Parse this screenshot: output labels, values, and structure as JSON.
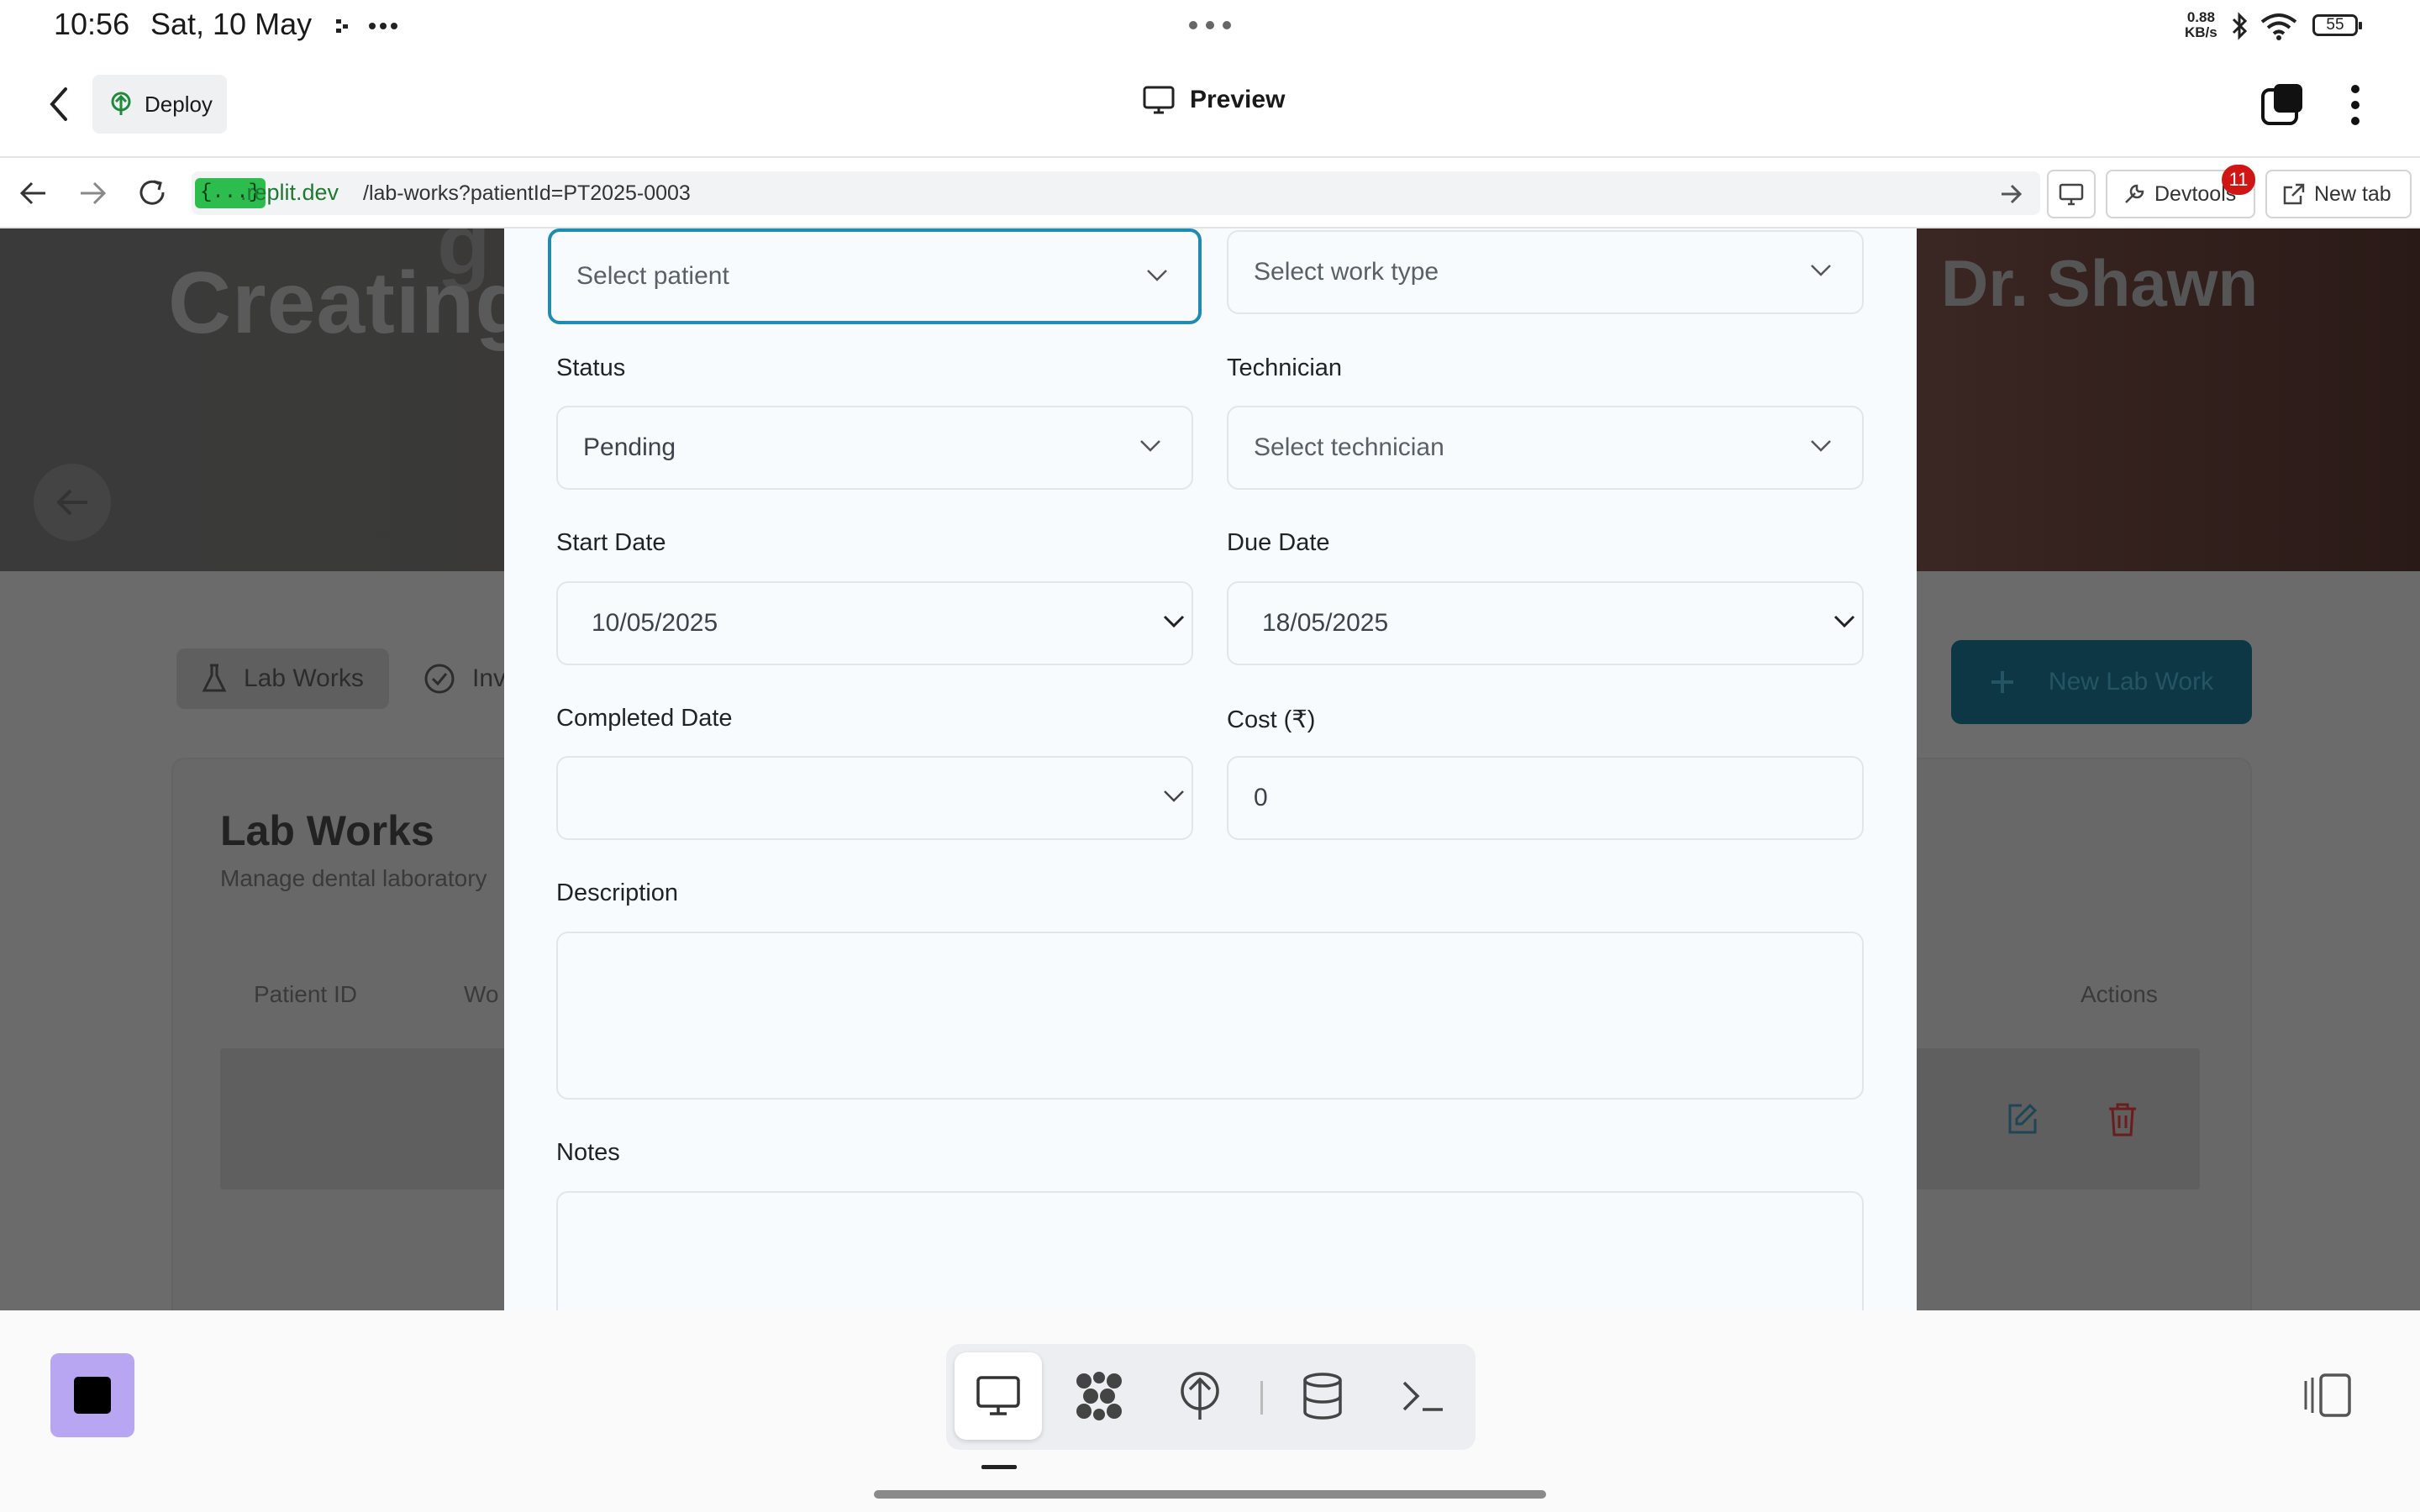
{
  "status_bar": {
    "time": "10:56",
    "date": "Sat, 10 May",
    "network_speed_value": "0.88",
    "network_speed_unit": "KB/s",
    "battery": "55"
  },
  "top_bar": {
    "deploy_label": "Deploy",
    "preview_label": "Preview"
  },
  "browser": {
    "domain_tag": "{...}",
    "domain": ".replit.dev",
    "path": "/lab-works?patientId=PT2025-0003",
    "devtools_label": "Devtools",
    "devtools_badge": "11",
    "new_tab_label": "New tab"
  },
  "background_app": {
    "hero_heading": "Creating",
    "hero_heading_partial": "g",
    "doctor_name": "Dr. Shawn",
    "tabs": [
      {
        "label": "Lab Works"
      },
      {
        "label": "Inv"
      }
    ],
    "new_button_label": "New Lab Work",
    "card_title": "Lab Works",
    "card_subtitle": "Manage dental laboratory",
    "columns": [
      "Patient ID",
      "Wo",
      "Actions"
    ]
  },
  "form": {
    "patient": {
      "placeholder": "Select patient"
    },
    "work_type": {
      "placeholder": "Select work type"
    },
    "status": {
      "label": "Status",
      "value": "Pending"
    },
    "technician": {
      "label": "Technician",
      "placeholder": "Select technician"
    },
    "start_date": {
      "label": "Start Date",
      "value": "10/05/2025"
    },
    "due_date": {
      "label": "Due Date",
      "value": "18/05/2025"
    },
    "completed_date": {
      "label": "Completed Date",
      "value": ""
    },
    "cost": {
      "label": "Cost (₹)",
      "value": "0"
    },
    "description": {
      "label": "Description",
      "value": ""
    },
    "notes": {
      "label": "Notes",
      "value": ""
    }
  },
  "colors": {
    "focus_ring": "#1f8bb0",
    "modal_bg": "#f7fbfe",
    "overlay": "#6b6b6b",
    "dock_stop": "#b9a6f2",
    "badge": "#d01515",
    "domain_green": "#2dbd4e"
  }
}
